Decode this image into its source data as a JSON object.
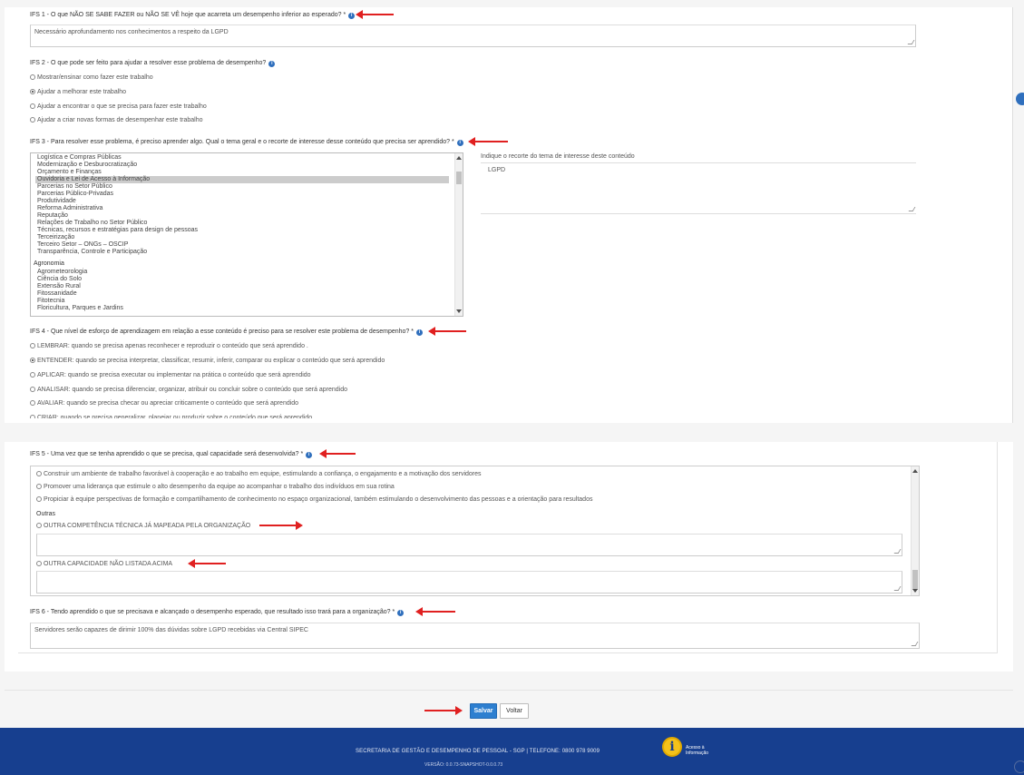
{
  "ifs1": {
    "label": "IFS 1 - O que NÃO SE SABE FAZER ou NÃO SE VÊ hoje que acarreta um desempenho inferior ao esperado? *",
    "value": "Necessário aprofundamento nos conhecimentos a respeito da LGPD"
  },
  "ifs2": {
    "label": "IFS 2 - O que pode ser feito para ajudar a resolver esse problema de desempenho?",
    "options": [
      "Mostrar/ensinar como fazer este trabalho",
      "Ajudar a melhorar este trabalho",
      "Ajudar a encontrar o que se precisa para fazer este trabalho",
      "Ajudar a criar novas formas de desempenhar este trabalho"
    ],
    "selected": 1
  },
  "ifs3": {
    "label": "IFS 3 - Para resolver esse problema, é preciso aprender algo. Qual o tema geral e o recorte de interesse desse conteúdo que precisa ser aprendido? *",
    "list_items": [
      "Logística e Compras Públicas",
      "Modernização e Desburocratização",
      "Orçamento e Finanças",
      "Ouvidoria e Lei de Acesso à Informação",
      "Parcerias no Setor Público",
      "Parcerias Público-Privadas",
      "Produtividade",
      "Reforma Administrativa",
      "Reputação",
      "Relações de Trabalho no Setor Público",
      "Técnicas, recursos e estratégias para design de pessoas",
      "Terceirização",
      "Terceiro Setor – ONGs – OSCIP",
      "Transparência, Controle e Participação"
    ],
    "selected_index": 3,
    "group_label": "Agronomia",
    "group_items": [
      "Agrometeorologia",
      "Ciência do Solo",
      "Extensão Rural",
      "Fitossanidade",
      "Fitotecnia",
      "Floricultura, Parques e Jardins"
    ],
    "recorte_label": "Indique o recorte do tema de interesse deste conteúdo",
    "recorte_value": "LGPD"
  },
  "ifs4": {
    "label": "IFS 4 - Que nível de esforço de aprendizagem em relação a esse conteúdo é preciso para se resolver este problema de desempenho? *",
    "options": [
      "LEMBRAR: quando se precisa apenas reconhecer e reproduzir o conteúdo que será aprendido .",
      "ENTENDER: quando se precisa interpretar, classificar, resumir, inferir, comparar ou explicar o conteúdo que será aprendido",
      "APLICAR: quando se precisa executar ou implementar na prática o conteúdo que será aprendido",
      "ANALISAR: quando se precisa diferenciar, organizar, atribuir ou concluir sobre o conteúdo que será aprendido",
      "AVALIAR: quando se precisa checar ou apreciar criticamente o conteúdo que será aprendido",
      "CRIAR: quando se precisa generalizar, planejar ou produzir sobre o conteúdo que será aprendido"
    ],
    "selected": 1
  },
  "ifs5": {
    "label": "IFS 5 - Uma vez que se tenha aprendido o que se precisa, qual capacidade será desenvolvida? *",
    "options": [
      "Construir um ambiente de trabalho favorável à cooperação e ao trabalho em equipe, estimulando a confiança, o engajamento e a motivação dos servidores",
      "Promover uma liderança que estimule o alto desempenho da equipe ao acompanhar o trabalho dos indivíduos em sua rotina",
      "Propiciar à equipe perspectivas de formação e compartilhamento de conhecimento no espaço organizacional, também estimulando o desenvolvimento das pessoas e a orientação para resultados"
    ],
    "others_label": "Outras",
    "other1": "OUTRA COMPETÊNCIA TÉCNICA JÁ MAPEADA PELA ORGANIZAÇÃO",
    "other2": "OUTRA CAPACIDADE NÃO LISTADA ACIMA"
  },
  "ifs6": {
    "label": "IFS 6 - Tendo aprendido o que se precisava e alcançado o desempenho esperado, que resultado isso trará para a organização? *",
    "value": "Servidores serão capazes de dirimir 100% das dúvidas sobre LGPD recebidas via Central SIPEC"
  },
  "buttons": {
    "save": "Salvar",
    "back": "Voltar"
  },
  "footer": {
    "line1": "SECRETARIA DE GESTÃO E DESEMPENHO DE PESSOAL - SGP | TELEFONE: 0800 978 9009",
    "line2": "VERSÃO: 0.0.73-SNAPSHOT-0.0.0.73",
    "badge_letter": "i",
    "badge_text_1": "Acesso à",
    "badge_text_2": "Informação"
  },
  "colors": {
    "arrow": "#e02020",
    "primary": "#2d7fd0",
    "footer": "#173f8f",
    "info": "#2f6fbd"
  }
}
